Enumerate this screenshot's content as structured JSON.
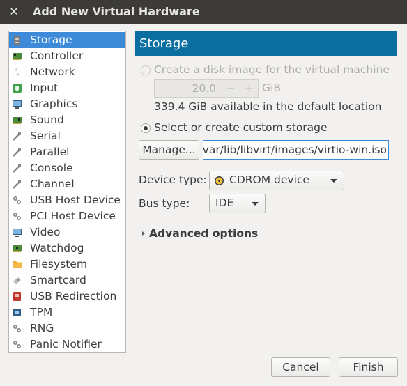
{
  "window": {
    "title": "Add New Virtual Hardware",
    "close_glyph": "✕"
  },
  "sidebar": {
    "items": [
      {
        "label": "Storage",
        "icon": "disk-icon",
        "selected": true
      },
      {
        "label": "Controller",
        "icon": "controller-icon"
      },
      {
        "label": "Network",
        "icon": "network-icon"
      },
      {
        "label": "Input",
        "icon": "input-icon"
      },
      {
        "label": "Graphics",
        "icon": "monitor-icon"
      },
      {
        "label": "Sound",
        "icon": "sound-card-icon"
      },
      {
        "label": "Serial",
        "icon": "serial-icon"
      },
      {
        "label": "Parallel",
        "icon": "parallel-icon"
      },
      {
        "label": "Console",
        "icon": "console-icon"
      },
      {
        "label": "Channel",
        "icon": "channel-icon"
      },
      {
        "label": "USB Host Device",
        "icon": "usb-icon"
      },
      {
        "label": "PCI Host Device",
        "icon": "pci-icon"
      },
      {
        "label": "Video",
        "icon": "video-icon"
      },
      {
        "label": "Watchdog",
        "icon": "watchdog-icon"
      },
      {
        "label": "Filesystem",
        "icon": "folder-icon"
      },
      {
        "label": "Smartcard",
        "icon": "smartcard-icon"
      },
      {
        "label": "USB Redirection",
        "icon": "usb-redirection-icon"
      },
      {
        "label": "TPM",
        "icon": "tpm-icon"
      },
      {
        "label": "RNG",
        "icon": "rng-icon"
      },
      {
        "label": "Panic Notifier",
        "icon": "panic-notifier-icon"
      }
    ]
  },
  "panel": {
    "header": "Storage",
    "create_disk": {
      "label": "Create a disk image for the virtual machine",
      "checked": false,
      "enabled": false
    },
    "size": {
      "value": "20.0",
      "unit": "GiB",
      "minus": "−",
      "plus": "+"
    },
    "available": "339.4 GiB available in the default location",
    "custom_storage": {
      "label": "Select or create custom storage",
      "checked": true
    },
    "manage_button": "Manage...",
    "path": "/var/lib/libvirt/images/virtio-win.iso",
    "device_type": {
      "label": "Device type:",
      "value": "CDROM device"
    },
    "bus_type": {
      "label": "Bus type:",
      "value": "IDE"
    },
    "advanced": "Advanced options"
  },
  "footer": {
    "cancel": "Cancel",
    "finish": "Finish"
  },
  "colors": {
    "selection": "#3d8bd8",
    "header": "#0b6ea1",
    "titlebar": "#3c3b37"
  }
}
